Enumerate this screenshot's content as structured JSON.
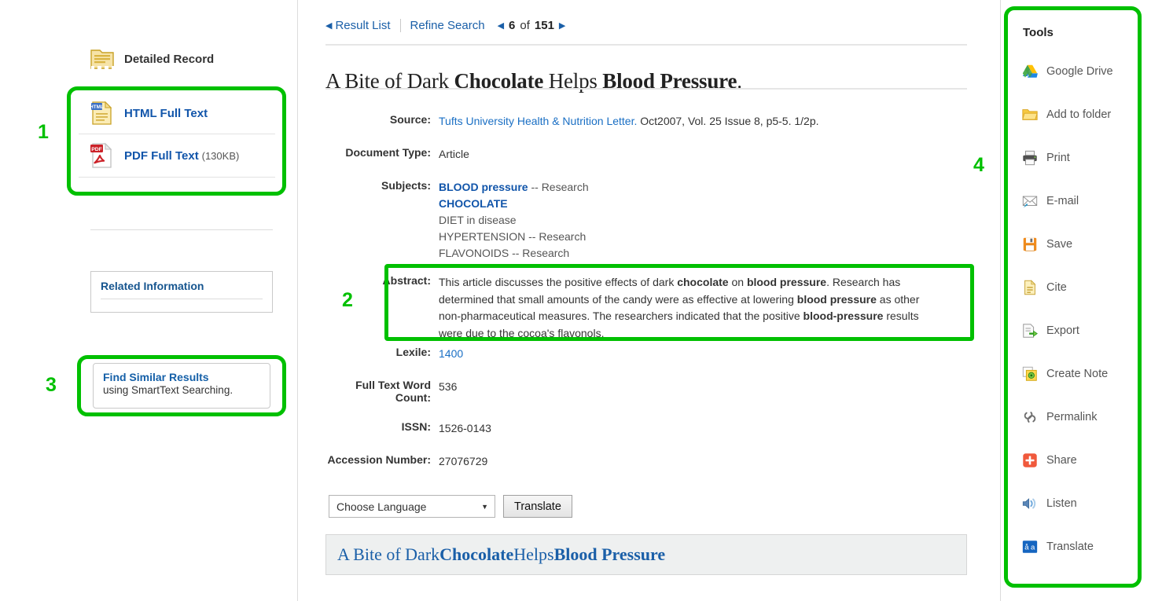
{
  "left": {
    "detailed_record": {
      "label": "Detailed Record",
      "icon": "folder-record-icon"
    },
    "full_text": [
      {
        "label": "HTML Full Text",
        "size": "",
        "icon": "html-document-icon"
      },
      {
        "label": "PDF Full Text",
        "size": "(130KB)",
        "icon": "pdf-document-icon"
      }
    ],
    "related_information": {
      "title": "Related Information"
    },
    "find_similar": {
      "title": "Find Similar Results",
      "subtitle": "using SmartText Searching."
    }
  },
  "toolbar": {
    "result_list": "Result List",
    "refine_search": "Refine Search",
    "prev_arrow": "◀",
    "next_arrow": "▶",
    "current": "6",
    "of": "of",
    "total": "151"
  },
  "article": {
    "title_parts": [
      {
        "text": "A Bite of Dark ",
        "bold": false
      },
      {
        "text": "Chocolate",
        "bold": true
      },
      {
        "text": " Helps ",
        "bold": false
      },
      {
        "text": "Blood Pressure",
        "bold": true
      },
      {
        "text": ".",
        "bold": false
      }
    ],
    "title_plain": "A Bite of Dark Chocolate Helps Blood Pressure.",
    "source_label": "Source:",
    "source_link": "Tufts University Health & Nutrition Letter.",
    "source_rest": " Oct2007, Vol. 25 Issue 8, p5-5. 1/2p.",
    "document_type_label": "Document Type:",
    "document_type_value": "Article",
    "subjects_label": "Subjects:",
    "subjects": [
      {
        "strong": "BLOOD pressure",
        "plain": " -- Research"
      },
      {
        "strong": "CHOCOLATE",
        "plain": ""
      },
      {
        "strong": "",
        "plain": "DIET in disease"
      },
      {
        "strong": "",
        "plain": "HYPERTENSION -- Research"
      },
      {
        "strong": "",
        "plain": "FLAVONOIDS -- Research"
      }
    ],
    "abstract_label": "Abstract:",
    "abstract_parts": [
      {
        "text": "This article discusses the positive effects of dark ",
        "bold": false
      },
      {
        "text": "chocolate",
        "bold": true
      },
      {
        "text": " on ",
        "bold": false
      },
      {
        "text": "blood pressure",
        "bold": true
      },
      {
        "text": ". Research has determined that small amounts of the candy were as effective at lowering ",
        "bold": false
      },
      {
        "text": "blood pressure",
        "bold": true
      },
      {
        "text": " as other non-pharmaceutical measures. The researchers indicated that the positive ",
        "bold": false
      },
      {
        "text": "blood-pressure",
        "bold": true
      },
      {
        "text": " results were due to the cocoa's flavonols.",
        "bold": false
      }
    ],
    "lexile_label": "Lexile:",
    "lexile_value": "1400",
    "word_count_label": "Full Text Word Count:",
    "word_count_value": "536",
    "issn_label": "ISSN:",
    "issn_value": "1526-0143",
    "accession_label": "Accession Number:",
    "accession_value": "27076729"
  },
  "translate": {
    "select_value": "Choose Language",
    "caret": "▼",
    "button_label": "Translate",
    "translated_title_parts": [
      {
        "text": "A Bite of Dark ",
        "bold": false
      },
      {
        "text": "Chocolate",
        "bold": true
      },
      {
        "text": " Helps ",
        "bold": false
      },
      {
        "text": "Blood Pressure",
        "bold": true
      }
    ]
  },
  "tools": {
    "title": "Tools",
    "items": [
      {
        "label": "Google Drive",
        "icon": "google-drive-icon"
      },
      {
        "label": "Add to folder",
        "icon": "folder-add-icon"
      },
      {
        "label": "Print",
        "icon": "printer-icon"
      },
      {
        "label": "E-mail",
        "icon": "envelope-icon"
      },
      {
        "label": "Save",
        "icon": "floppy-disk-icon"
      },
      {
        "label": "Cite",
        "icon": "cite-document-icon"
      },
      {
        "label": "Export",
        "icon": "export-icon"
      },
      {
        "label": "Create Note",
        "icon": "note-icon"
      },
      {
        "label": "Permalink",
        "icon": "link-chain-icon"
      },
      {
        "label": "Share",
        "icon": "share-plus-icon"
      },
      {
        "label": "Listen",
        "icon": "speaker-icon"
      },
      {
        "label": "Translate",
        "icon": "translate-icon"
      }
    ]
  },
  "annotations": {
    "accent_color": "#00c000",
    "numbers": [
      "1",
      "2",
      "3",
      "4"
    ]
  }
}
